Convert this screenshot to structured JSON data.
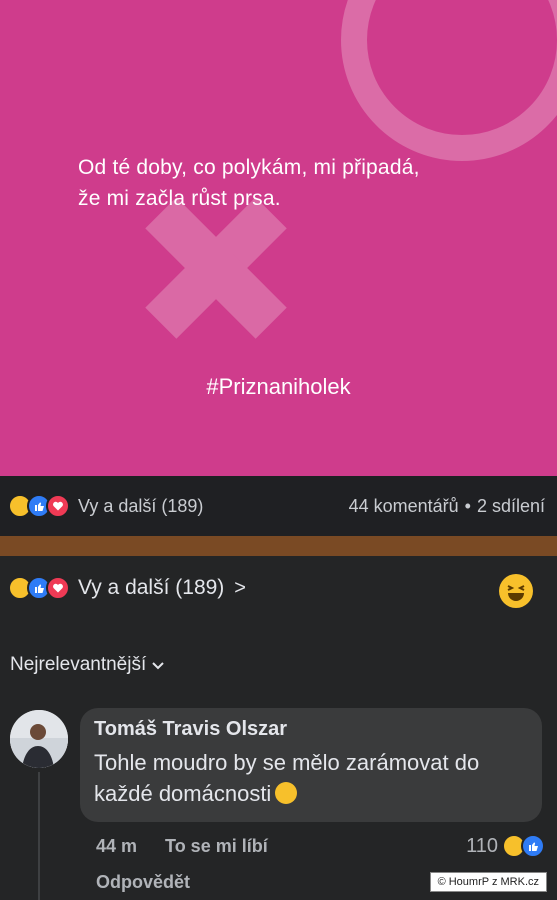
{
  "post": {
    "quote_line1": "Od té doby, co polykám, mi připadá,",
    "quote_line2": "že mi začla růst prsa.",
    "hashtag": "#Priznaniholek",
    "background": "#cf3c8c"
  },
  "post_bar": {
    "reactions": [
      "haha",
      "like",
      "love"
    ],
    "reactions_label": "Vy a další (189)",
    "comments_label": "44 komentářů",
    "separator": "•",
    "shares_label": "2 sdílení"
  },
  "comments_section": {
    "reactions": [
      "haha",
      "like",
      "love"
    ],
    "reactions_label": "Vy a další (189)",
    "chevron": ">",
    "sort_label": "Nejrelevantnější",
    "comment": {
      "author": "Tomáš Travis Olszar",
      "text": "Tohle moudro by se mělo zarámovat do každé domácnosti",
      "time": "44 m",
      "like_label": "To se mi líbí",
      "reply_label": "Odpovědět",
      "reaction_count": "110",
      "reactions": [
        "haha",
        "like"
      ]
    }
  },
  "watermark": "© HoumrP z MRK.cz"
}
